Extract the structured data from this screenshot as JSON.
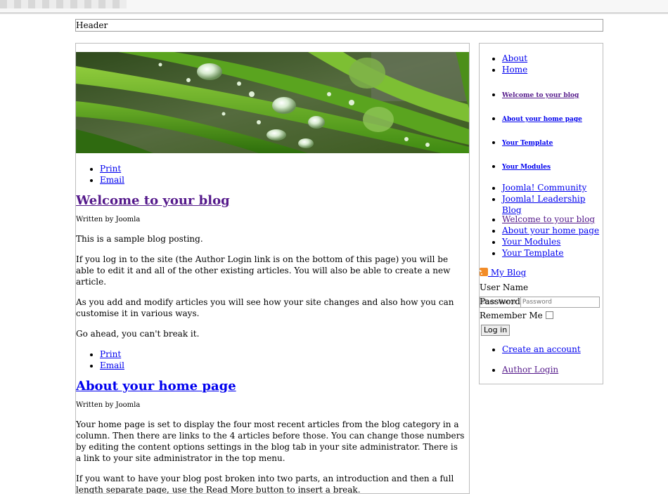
{
  "page": {
    "header_text": "Header"
  },
  "main": {
    "icons_1": [
      {
        "label": " Print"
      },
      {
        "label": " Email"
      }
    ],
    "article1": {
      "title": "Welcome to your blog",
      "byline": "Written by Joomla",
      "paragraphs": [
        "This is a sample blog posting.",
        "If you log in to the site (the Author Login link is on the bottom of this page) you will be able to edit it and all of the other existing articles. You will also be able to create a new article.",
        "As you add and modify articles you will see how your site changes and also how you can customise it in various ways.",
        "Go ahead, you can't break it."
      ]
    },
    "icons_2": [
      {
        "label": " Print"
      },
      {
        "label": " Email"
      }
    ],
    "article2": {
      "title": "About your home page",
      "byline": "Written by Joomla",
      "paragraphs": [
        "Your home page is set to display the four most recent articles from the blog category in a column. Then there are links to the 4 articles before those. You can change those numbers by editing the content options settings in the blog tab in your site administrator. There is a link to your site administrator in the top menu.",
        "If you want to have your blog post broken into two parts, an introduction and then a full length separate page, use the Read More button to insert a break."
      ]
    }
  },
  "sidebar": {
    "menu_top": [
      {
        "label": "About"
      },
      {
        "label": "Home"
      }
    ],
    "bold_links": [
      {
        "label": "Welcome to your blog"
      },
      {
        "label": "About your home page"
      },
      {
        "label": "Your Template"
      },
      {
        "label": "Your Modules"
      }
    ],
    "external_links": [
      {
        "label": "Joomla! Community"
      },
      {
        "label": "Joomla! Leadership Blog"
      }
    ],
    "article_links": [
      {
        "label": "Welcome to your blog"
      },
      {
        "label": "About your home page"
      },
      {
        "label": "Your Modules"
      },
      {
        "label": "Your Template"
      }
    ],
    "feed_label": " My Blog",
    "login": {
      "username_label": "User Name",
      "username_placeholder": "User Name",
      "password_label": "Password",
      "password_placeholder": "Password",
      "remember_label": "Remember Me",
      "submit_label": "Log in"
    },
    "create_account": "Create an account",
    "author_login": "Author Login"
  },
  "colors": {
    "link": "#0000ee",
    "visited_link": "#551a8b",
    "border": "#bdbdbd"
  }
}
